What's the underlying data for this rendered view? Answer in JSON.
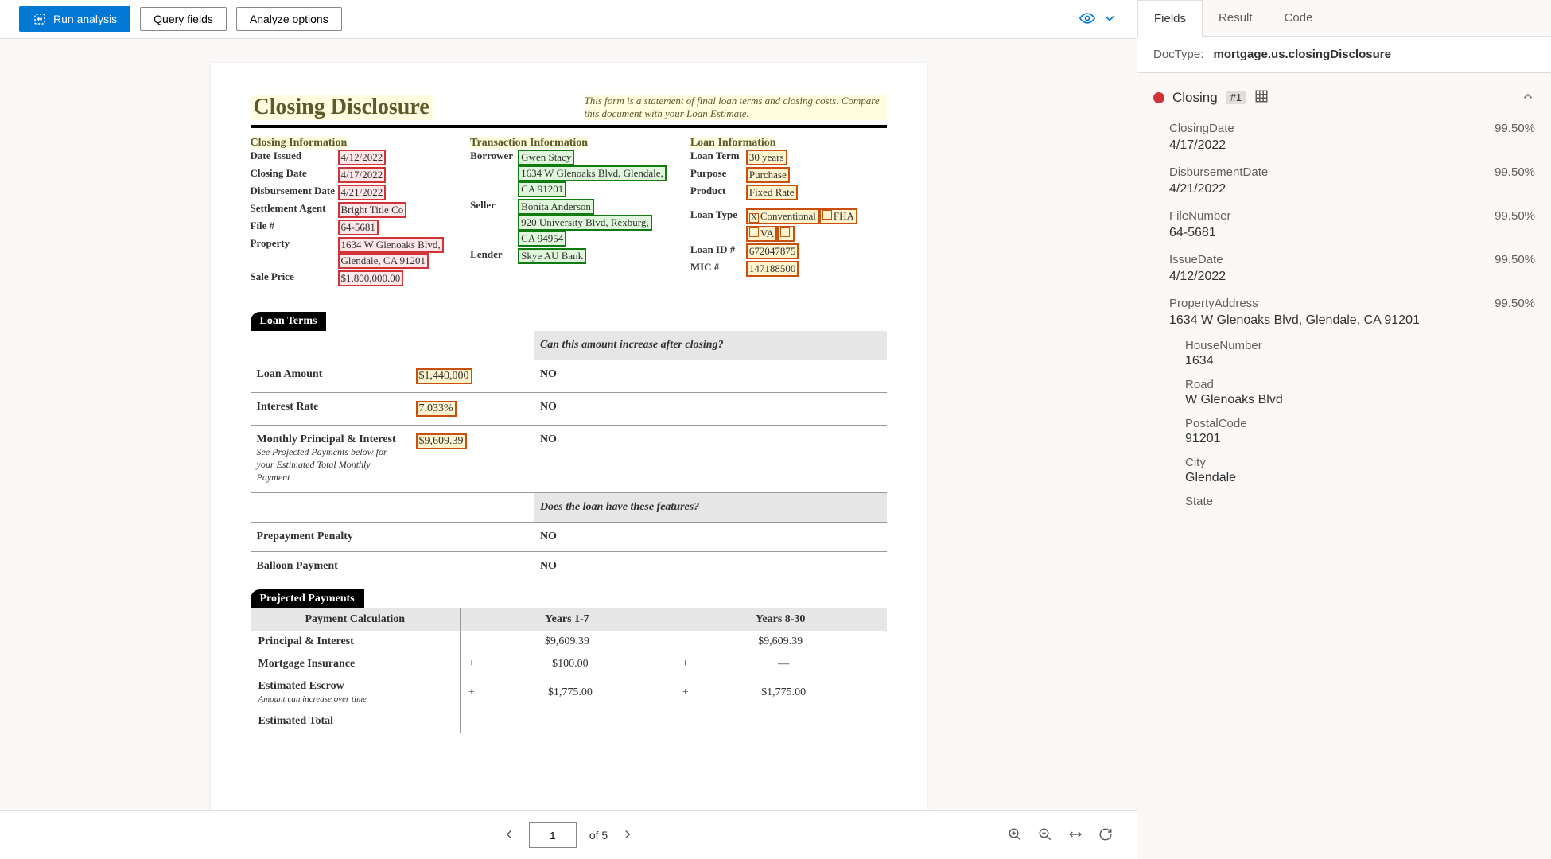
{
  "toolbar": {
    "run": "Run analysis",
    "query": "Query fields",
    "analyze": "Analyze options"
  },
  "document": {
    "title": "Closing Disclosure",
    "subtitle": "This form is a statement of final loan terms and closing costs. Compare this document with your Loan Estimate.",
    "closingInfo": {
      "heading": "Closing  Information",
      "dateIssuedLabel": "Date Issued",
      "dateIssued": "4/12/2022",
      "closingDateLabel": "Closing Date",
      "closingDate": "4/17/2022",
      "disbursementDateLabel": "Disbursement Date",
      "disbursementDate": "4/21/2022",
      "settlementAgentLabel": "Settlement Agent",
      "settlementAgent": "Bright  Title Co",
      "fileNumLabel": "File #",
      "fileNum": "64-5681",
      "propertyLabel": "Property",
      "property1": "1634 W Glenoaks Blvd,",
      "property2": "Glendale, CA 91201",
      "salePriceLabel": "Sale Price",
      "salePrice": "$1,800,000.00"
    },
    "transactionInfo": {
      "heading": "Transaction  Information",
      "borrowerLabel": "Borrower",
      "borrower1": "Gwen Stacy",
      "borrower2": "1634 W Glenoaks Blvd, Glendale,",
      "borrower3": "CA 91201",
      "sellerLabel": "Seller",
      "seller1": "Bonita Anderson",
      "seller2": "920 University Blvd, Rexburg,",
      "seller3": "CA 94954",
      "lenderLabel": "Lender",
      "lender": "Skye AU Bank"
    },
    "loanInfo": {
      "heading": "Loan  Information",
      "loanTermLabel": "Loan Term",
      "loanTerm": "30 years",
      "purposeLabel": "Purpose",
      "purpose": "Purchase",
      "productLabel": "Product",
      "product": "Fixed Rate",
      "loanTypeLabel": "Loan Type",
      "conventional": "Conventional",
      "fha": "FHA",
      "va": "VA",
      "loanIdLabel": "Loan ID #",
      "loanId": "672047875",
      "micLabel": "MIC #",
      "mic": "147188500"
    },
    "loanTerms": {
      "sectionTitle": "Loan Terms",
      "increaseHdr": "Can this amount increase after closing?",
      "loanAmountLabel": "Loan Amount",
      "loanAmount": "$1,440,000",
      "loanAmountAns": "NO",
      "interestRateLabel": "Interest Rate",
      "interestRate": "7.033%",
      "interestRateAns": "NO",
      "monthlyPILabel": "Monthly Principal & Interest",
      "monthlyPI": "$9,609.39",
      "monthlyPIAns": "NO",
      "monthlyNote": "See Projected Payments below for your Estimated Total Monthly Payment",
      "featuresHdr": "Does the loan have these features?",
      "prepayLabel": "Prepayment Penalty",
      "prepayAns": "NO",
      "balloonLabel": "Balloon Payment",
      "balloonAns": "NO"
    },
    "projected": {
      "sectionTitle": "Projected Payments",
      "calcLabel": "Payment Calculation",
      "y17": "Years 1-7",
      "y830": "Years 8-30",
      "piLabel": "Principal & Interest",
      "pi1": "$9,609.39",
      "pi2": "$9,609.39",
      "miLabel": "Mortgage Insurance",
      "mi1": "$100.00",
      "mi2": "—",
      "escrowLabel": "Estimated Escrow",
      "escrowNote": "Amount can increase over time",
      "escrow1": "$1,775.00",
      "escrow2": "$1,775.00",
      "estTotalLabel": "Estimated Total"
    }
  },
  "pager": {
    "current": "1",
    "of": "of 5"
  },
  "tabs": {
    "fields": "Fields",
    "result": "Result",
    "code": "Code"
  },
  "doctype": {
    "label": "DocType:",
    "value": "mortgage.us.closingDisclosure"
  },
  "group": {
    "name": "Closing",
    "badge": "#1"
  },
  "fields": [
    {
      "name": "ClosingDate",
      "conf": "99.50%",
      "value": "4/17/2022"
    },
    {
      "name": "DisbursementDate",
      "conf": "99.50%",
      "value": "4/21/2022"
    },
    {
      "name": "FileNumber",
      "conf": "99.50%",
      "value": "64-5681"
    },
    {
      "name": "IssueDate",
      "conf": "99.50%",
      "value": "4/12/2022"
    },
    {
      "name": "PropertyAddress",
      "conf": "99.50%",
      "value": "1634 W Glenoaks Blvd, Glendale, CA 91201"
    }
  ],
  "subfields": [
    {
      "name": "HouseNumber",
      "value": "1634"
    },
    {
      "name": "Road",
      "value": "W Glenoaks Blvd"
    },
    {
      "name": "PostalCode",
      "value": "91201"
    },
    {
      "name": "City",
      "value": "Glendale"
    },
    {
      "name": "State",
      "value": ""
    }
  ]
}
